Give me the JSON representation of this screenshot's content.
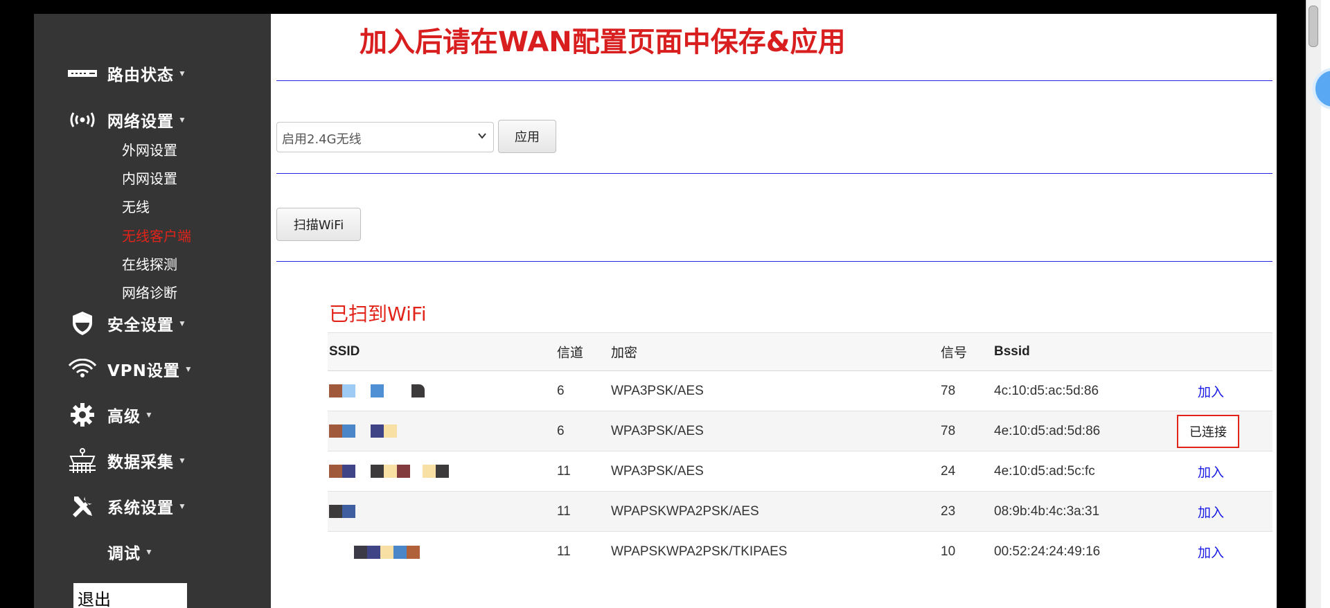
{
  "sidebar": {
    "menu": [
      {
        "label": "路由状态",
        "icon": "router-icon"
      },
      {
        "label": "网络设置",
        "icon": "broadcast-icon"
      },
      {
        "label": "安全设置",
        "icon": "shield-icon"
      },
      {
        "label": "VPN设置",
        "icon": "vpn-signal-icon"
      },
      {
        "label": "高级",
        "icon": "gear-icon"
      },
      {
        "label": "数据采集",
        "icon": "data-collection-icon"
      },
      {
        "label": "系统设置",
        "icon": "tools-icon"
      },
      {
        "label": "调试",
        "icon": ""
      }
    ],
    "submenu": [
      "外网设置",
      "内网设置",
      "无线",
      "无线客户端",
      "在线探测",
      "网络诊断"
    ],
    "active_submenu": "无线客户端",
    "logout": "退出"
  },
  "main": {
    "headline": "加入后请在WAN配置页面中保存&应用",
    "wireless_select": {
      "value": "启用2.4G无线"
    },
    "apply_label": "应用",
    "scan_label": "扫描WiFi",
    "scanned_title": "已扫到WiFi",
    "table": {
      "headers": {
        "ssid": "SSID",
        "channel": "信道",
        "encryption": "加密",
        "signal": "信号",
        "bssid": "Bssid"
      },
      "rows": [
        {
          "channel": "6",
          "encryption": "WPA3PSK/AES",
          "signal": "78",
          "bssid": "4c:10:d5:ac:5d:86",
          "action": "加入",
          "connected": false
        },
        {
          "channel": "6",
          "encryption": "WPA3PSK/AES",
          "signal": "78",
          "bssid": "4e:10:d5:ad:5d:86",
          "action": "已连接",
          "connected": true
        },
        {
          "channel": "11",
          "encryption": "WPA3PSK/AES",
          "signal": "24",
          "bssid": "4e:10:d5:ad:5c:fc",
          "action": "加入",
          "connected": false
        },
        {
          "channel": "11",
          "encryption": "WPAPSKWPA2PSK/AES",
          "signal": "23",
          "bssid": "08:9b:4b:4c:3a:31",
          "action": "加入",
          "connected": false
        },
        {
          "channel": "11",
          "encryption": "WPAPSKWPA2PSK/TKIPAES",
          "signal": "10",
          "bssid": "00:52:24:24:49:16",
          "action": "加入",
          "connected": false
        }
      ]
    }
  },
  "colors": {
    "sidebar_bg": "#353535",
    "accent_red": "#e2231a",
    "divider_blue": "#2323e6",
    "link_blue": "#1a1ae6"
  }
}
